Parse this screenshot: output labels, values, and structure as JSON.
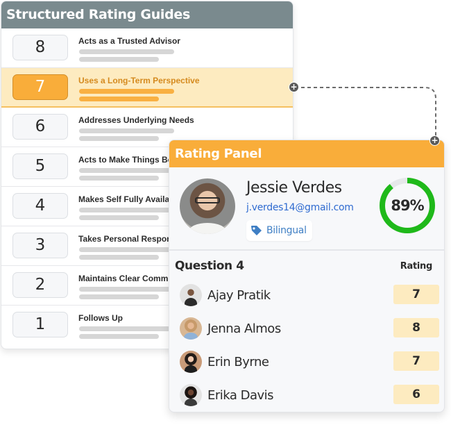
{
  "guides": {
    "title": "Structured Rating Guides",
    "items": [
      {
        "number": "8",
        "label": "Acts as a Trusted Advisor",
        "active": false
      },
      {
        "number": "7",
        "label": "Uses a Long-Term Perspective",
        "active": true
      },
      {
        "number": "6",
        "label": "Addresses Underlying Needs",
        "active": false
      },
      {
        "number": "5",
        "label": "Acts to Make Things Better",
        "active": false
      },
      {
        "number": "4",
        "label": "Makes Self Fully Available",
        "active": false
      },
      {
        "number": "3",
        "label": "Takes Personal Responsibility",
        "active": false
      },
      {
        "number": "2",
        "label": "Maintains Clear Communication",
        "active": false
      },
      {
        "number": "1",
        "label": "Follows Up",
        "active": false
      }
    ]
  },
  "connector": {
    "icon": "plus-icon",
    "glyph": "+"
  },
  "rating_panel": {
    "title": "Rating Panel",
    "candidate": {
      "name": "Jessie Verdes",
      "email": "j.verdes14@gmail.com",
      "tag": {
        "icon": "tag-icon",
        "label": "Bilingual"
      },
      "score_percent": 89,
      "score_label": "89%"
    },
    "question": {
      "title": "Question 4",
      "rating_header": "Rating",
      "raters": [
        {
          "name": "Ajay Pratik",
          "rating": "7"
        },
        {
          "name": "Jenna Almos",
          "rating": "8"
        },
        {
          "name": "Erin Byrne",
          "rating": "7"
        },
        {
          "name": "Erika Davis",
          "rating": "6"
        }
      ]
    }
  },
  "colors": {
    "guides_header": "#7a8a8e",
    "accent_orange": "#f9ad3a",
    "active_row": "#fdebc0",
    "gauge_green": "#1fb91a",
    "gauge_track": "#e6e8ea",
    "email_blue": "#2f6bd0",
    "tag_blue": "#3f7fc4"
  }
}
